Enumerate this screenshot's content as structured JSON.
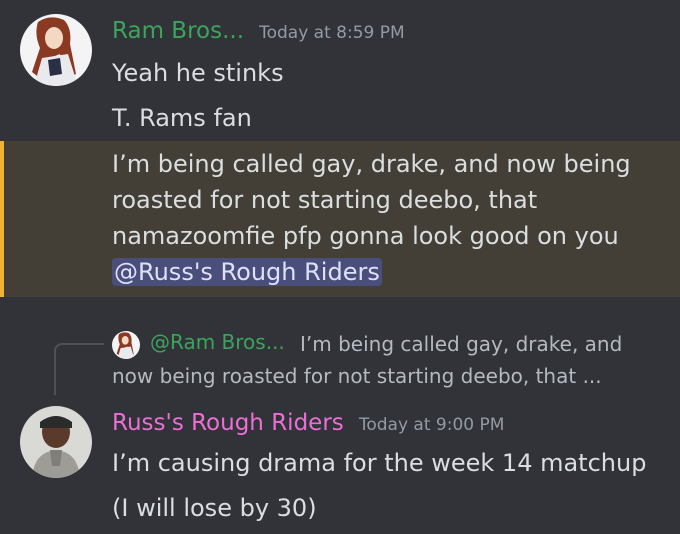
{
  "messages": [
    {
      "username": "Ram Bros...",
      "username_color": "#3ba55c",
      "timestamp": "Today at 8:59 PM",
      "lines": [
        "Yeah he stinks",
        "T. Rams fan"
      ]
    },
    {
      "lines": [
        "I’m being called gay, drake, and now being",
        "roasted for not starting deebo, that",
        "namazoomfie pfp gonna look good on you"
      ],
      "mention": "@Russ's Rough Riders",
      "highlight_color": "#f0b232"
    },
    {
      "reply": {
        "username": "@Ram Bros...",
        "text_line1": "I’m being called gay, drake, and",
        "text_line2": "now being roasted for not starting deebo, that ..."
      },
      "username": "Russ's Rough Riders",
      "username_color": "#eb6fd5",
      "timestamp": "Today at 9:00 PM",
      "lines": [
        "I’m causing drama for the week 14 matchup",
        "(I will lose by 30)"
      ]
    }
  ]
}
